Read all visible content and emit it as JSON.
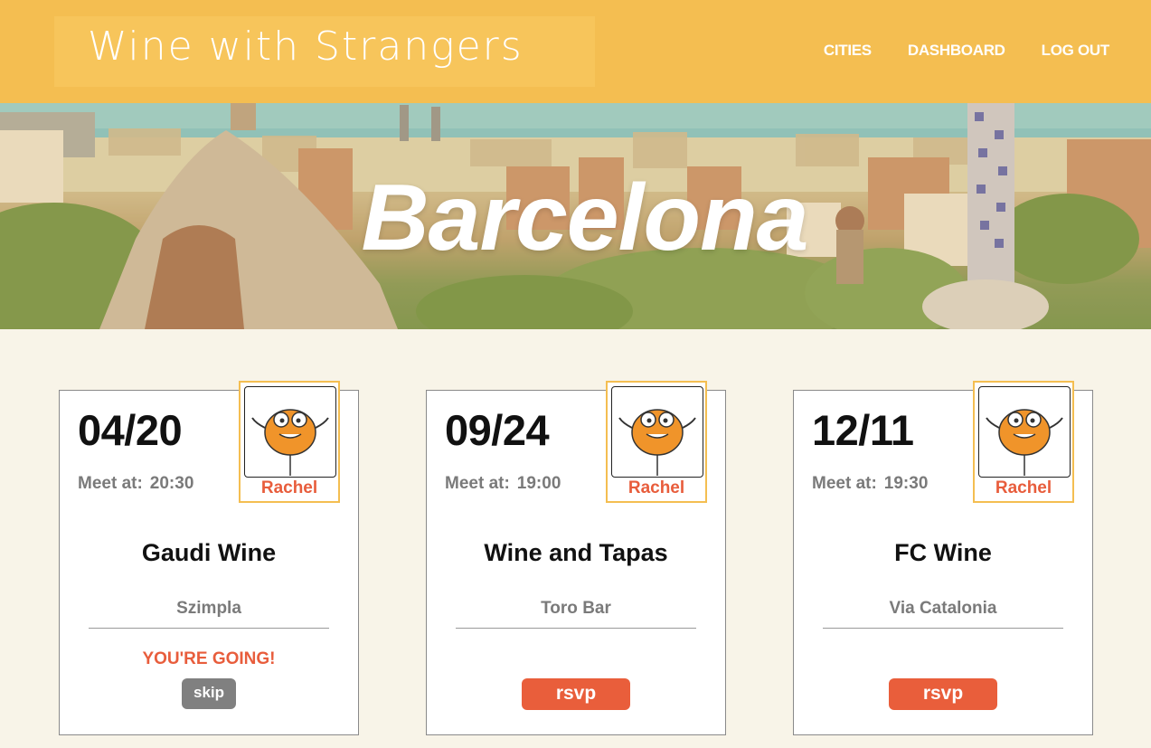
{
  "header": {
    "logo": "Wine with Strangers",
    "nav": [
      {
        "label": "CITIES"
      },
      {
        "label": "DASHBOARD"
      },
      {
        "label": "LOG OUT"
      }
    ]
  },
  "hero": {
    "city": "Barcelona"
  },
  "colors": {
    "header_bg": "#f4be51",
    "page_bg": "#f8f4e8",
    "accent": "#e85d3c",
    "skip_button": "#808080"
  },
  "events": [
    {
      "date": "04/20",
      "meet_label": "Meet at:",
      "time": "20:30",
      "host": "Rachel",
      "title": "Gaudi Wine",
      "venue": "Szimpla",
      "status": "YOU'RE GOING!",
      "action": "skip"
    },
    {
      "date": "09/24",
      "meet_label": "Meet at:",
      "time": "19:00",
      "host": "Rachel",
      "title": "Wine and Tapas",
      "venue": "Toro Bar",
      "status": "",
      "action": "rsvp"
    },
    {
      "date": "12/11",
      "meet_label": "Meet at:",
      "time": "19:30",
      "host": "Rachel",
      "title": "FC Wine",
      "venue": "Via Catalonia",
      "status": "",
      "action": "rsvp"
    }
  ]
}
